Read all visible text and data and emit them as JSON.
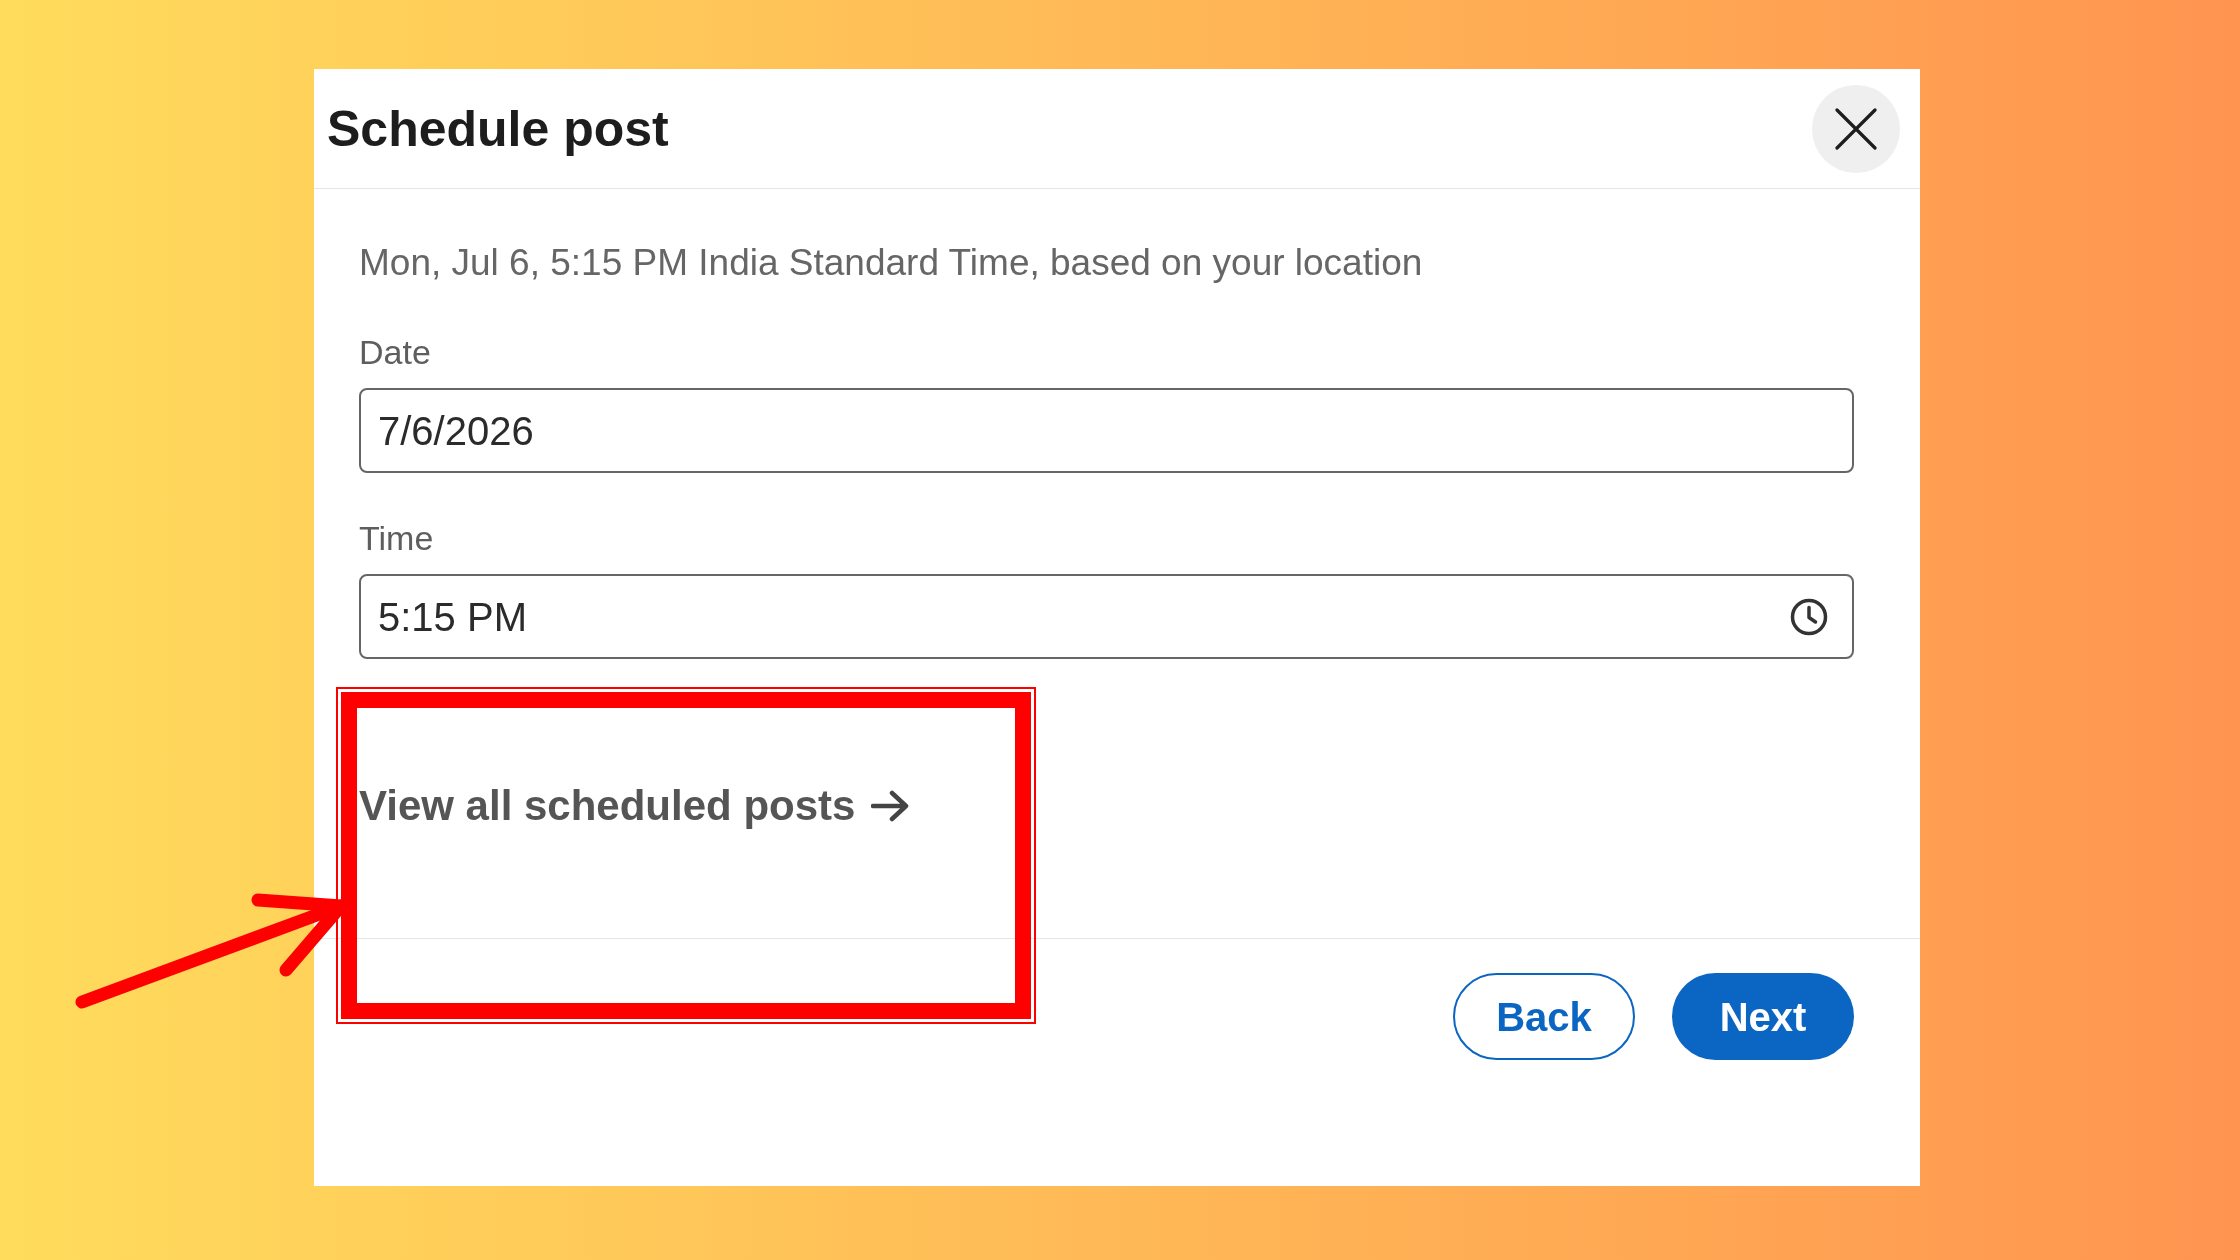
{
  "dialog": {
    "title": "Schedule post",
    "timezone_note": "Mon, Jul 6, 5:15 PM India Standard Time, based on your location",
    "fields": [
      {
        "kind": "date",
        "label": "Date",
        "value": "7/6/2026"
      },
      {
        "kind": "time",
        "label": "Time",
        "value": "5:15 PM"
      }
    ],
    "scheduled_posts_link": "View all scheduled posts",
    "buttons": [
      {
        "kind": "secondary",
        "label": "Back"
      },
      {
        "kind": "primary",
        "label": "Next"
      }
    ]
  }
}
